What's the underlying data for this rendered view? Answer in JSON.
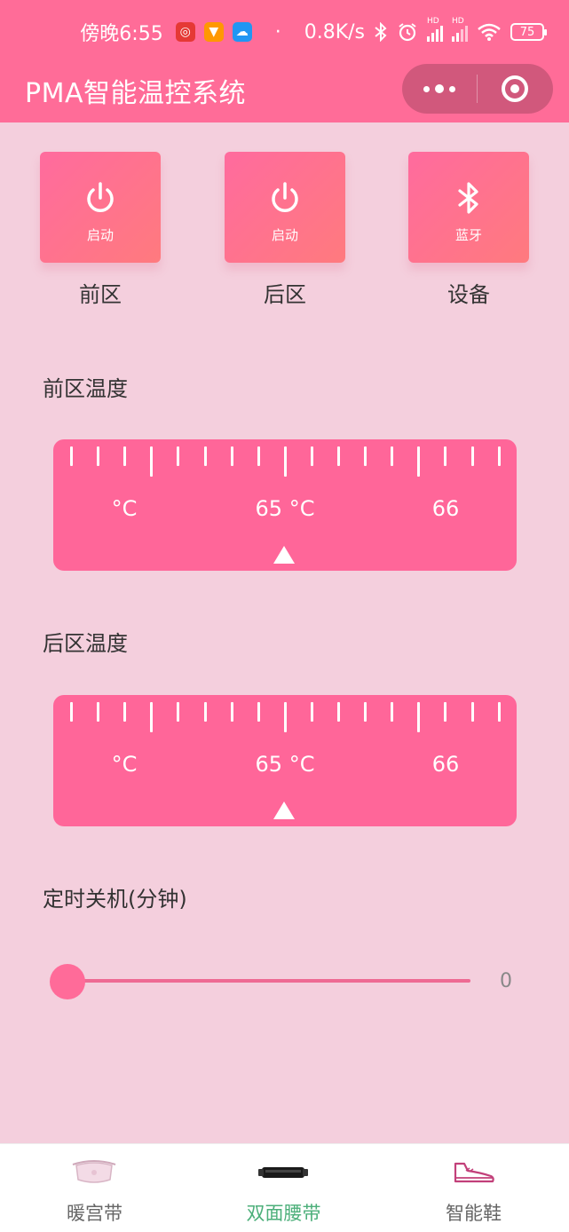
{
  "status_bar": {
    "time": "傍晚6:55",
    "network_speed": "0.8K/s",
    "battery": "75",
    "signal1_label": "HD",
    "signal2_label": "HD",
    "icons": [
      "netease-music-icon",
      "fox-app-icon",
      "cloud-app-icon",
      "bluetooth-icon",
      "alarm-icon",
      "signal-icon",
      "wifi-icon",
      "battery-icon"
    ]
  },
  "nav": {
    "title": "PMA智能温控系统"
  },
  "controls": [
    {
      "label": "启动",
      "zone": "前区",
      "icon": "power-icon"
    },
    {
      "label": "启动",
      "zone": "后区",
      "icon": "power-icon"
    },
    {
      "label": "蓝牙",
      "zone": "设备",
      "icon": "bluetooth-icon"
    }
  ],
  "front_temp": {
    "title": "前区温度",
    "labels": [
      "°C",
      "65 °C",
      "66"
    ],
    "value": 65,
    "unit": "°C"
  },
  "rear_temp": {
    "title": "后区温度",
    "labels": [
      "°C",
      "65 °C",
      "66"
    ],
    "value": 65,
    "unit": "°C"
  },
  "timer": {
    "title": "定时关机(分钟)",
    "value": "0"
  },
  "tabs": [
    {
      "label": "暖宫带",
      "active": false,
      "icon": "waist-belt-icon"
    },
    {
      "label": "双面腰带",
      "active": true,
      "icon": "double-belt-icon"
    },
    {
      "label": "智能鞋",
      "active": false,
      "icon": "shoe-icon"
    }
  ],
  "colors": {
    "primary": "#ff6c98",
    "background": "#f4cfdd",
    "ruler": "#ff6699",
    "active_tab": "#4caf7a"
  }
}
